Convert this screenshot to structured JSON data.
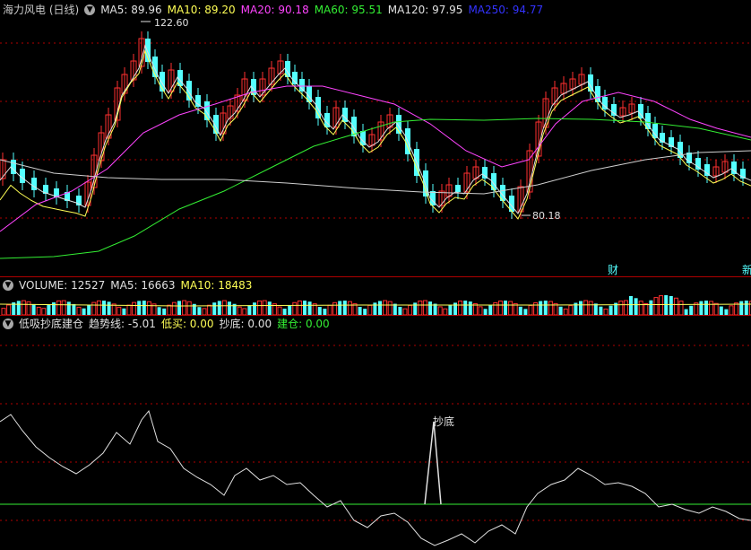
{
  "main": {
    "title": "海力风电 (日线)",
    "ma": [
      {
        "label": "MA5: 89.96",
        "color": "#e0e0e0"
      },
      {
        "label": "MA10: 89.20",
        "color": "#ffff55"
      },
      {
        "label": "MA20: 90.18",
        "color": "#ff44ff"
      },
      {
        "label": "MA60: 95.51",
        "color": "#33ee33"
      },
      {
        "label": "MA120: 97.95",
        "color": "#e0e0e0"
      },
      {
        "label": "MA250: 94.77",
        "color": "#3333ff"
      }
    ],
    "high_label": "122.60",
    "low_label": "80.18",
    "badge_cai": "财",
    "badge_right": "新"
  },
  "volume": {
    "title": "VOLUME: 12527",
    "ma5": "MA5: 16663",
    "ma10": "MA10: 18483",
    "ma5_color": "#e0e0e0",
    "ma10_color": "#ffff55"
  },
  "indicator": {
    "title": "低吸抄底建仓",
    "trend": "趋势线: -5.01",
    "dimai": "低买: 0.00",
    "chaodi": "抄底: 0.00",
    "jiancang": "建仓: 0.00",
    "chaodi_mark": "抄底",
    "colors": {
      "trend": "#e0e0e0",
      "dimai": "#ffff55",
      "chaodi": "#e0e0e0",
      "jiancang": "#33ee33"
    }
  },
  "colors": {
    "up": "#ff3030",
    "down": "#54ffff",
    "grid": "#b00000"
  }
}
